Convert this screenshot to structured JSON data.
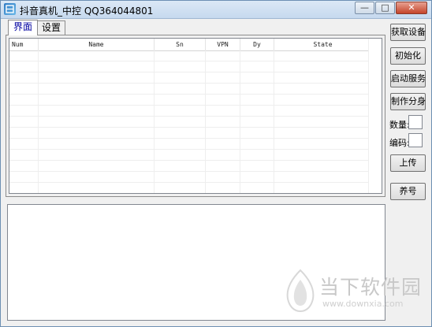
{
  "window": {
    "title": "抖音真机_中控  QQ364044801",
    "minimize_glyph": "—",
    "maximize_glyph": "□",
    "close_glyph": "✕"
  },
  "tabs": [
    {
      "label": "界面",
      "active": true
    },
    {
      "label": "设置",
      "active": false
    }
  ],
  "table": {
    "columns": [
      "Num",
      "Name",
      "Sn",
      "VPN",
      "Dy",
      "State"
    ],
    "rows": []
  },
  "buttons": {
    "get_device": "获取设备",
    "initialize": "初始化",
    "start_service": "启动服务",
    "make_clone": "制作分身",
    "upload": "上传",
    "nurture": "养号"
  },
  "fields": {
    "quantity_label": "数量:",
    "quantity_value": "",
    "code_label": "编码:",
    "code_value": ""
  },
  "log": {
    "content": ""
  },
  "watermark": {
    "name": "当下软件园",
    "url": "www.downxia.com"
  },
  "icons": {
    "app": "app-icon",
    "watermark_logo": "downxia-logo-icon"
  }
}
